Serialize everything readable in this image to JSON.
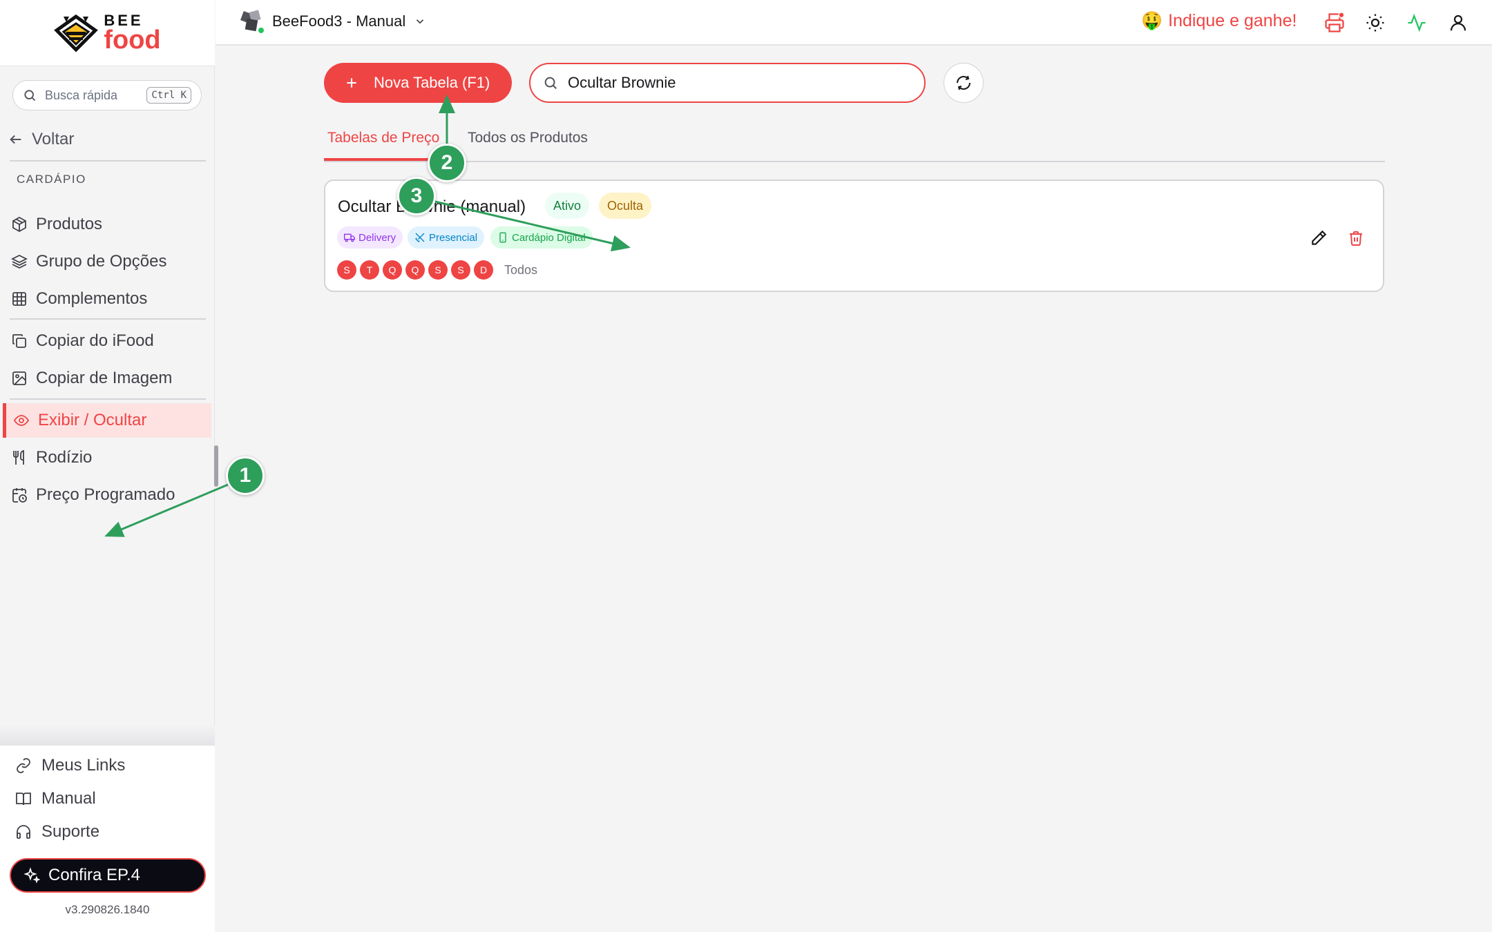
{
  "sidebar": {
    "logo": {
      "top": "BEE",
      "bottom": "food"
    },
    "search": {
      "placeholder": "Busca rápida",
      "shortcut": "Ctrl K"
    },
    "back_label": "Voltar",
    "section_label": "CARDÁPIO",
    "items": [
      {
        "label": "Produtos",
        "icon": "box-icon"
      },
      {
        "label": "Grupo de Opções",
        "icon": "layers-icon"
      },
      {
        "label": "Complementos",
        "icon": "grid-icon"
      },
      {
        "label": "Copiar do iFood",
        "icon": "ifood-copy-icon"
      },
      {
        "label": "Copiar de Imagem",
        "icon": "image-copy-icon"
      },
      {
        "label": "Exibir / Ocultar",
        "icon": "eye-icon",
        "active": true
      },
      {
        "label": "Rodízio",
        "icon": "utensils-icon"
      },
      {
        "label": "Preço Programado",
        "icon": "calendar-clock-icon"
      }
    ],
    "bottom": [
      {
        "label": "Meus Links",
        "icon": "link-icon"
      },
      {
        "label": "Manual",
        "icon": "book-icon"
      },
      {
        "label": "Suporte",
        "icon": "headset-icon"
      }
    ],
    "confira_label": "Confira EP.4",
    "version": "v3.290826.1840"
  },
  "topbar": {
    "store_name": "BeeFood3 - Manual",
    "refer_emoji": "🤑",
    "refer_label": "Indique e ganhe!",
    "icons": [
      "printer-icon",
      "sun-icon",
      "activity-icon",
      "user-icon"
    ]
  },
  "main": {
    "new_button_label": "Nova Tabela (F1)",
    "search_value": "Ocultar Brownie",
    "tabs": [
      {
        "label": "Tabelas de Preço",
        "active": true
      },
      {
        "label": "Todos os Produtos",
        "active": false
      }
    ],
    "card": {
      "title": "Ocultar Brownie (manual)",
      "status_badges": [
        "Ativo",
        "Oculta"
      ],
      "channels": [
        "Delivery",
        "Presencial",
        "Cardápio Digital"
      ],
      "days": [
        "S",
        "T",
        "Q",
        "Q",
        "S",
        "S",
        "D"
      ],
      "days_label": "Todos"
    }
  },
  "annotations": [
    "1",
    "2",
    "3"
  ],
  "colors": {
    "accent": "#ef4444",
    "annotation": "#2e9e5b",
    "active_bg": "#fee2e2"
  }
}
